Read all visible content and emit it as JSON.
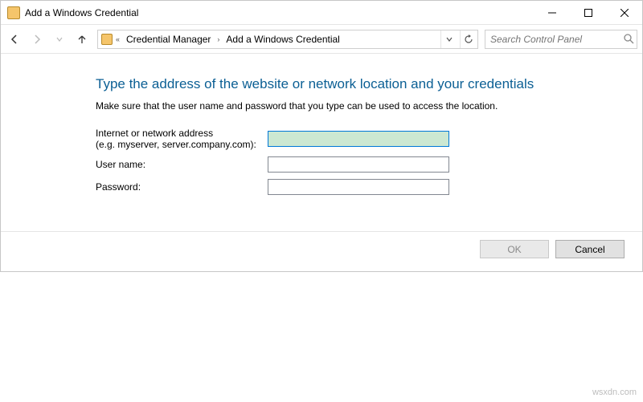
{
  "window": {
    "title": "Add a Windows Credential"
  },
  "breadcrumb": {
    "item1": "Credential Manager",
    "item2": "Add a Windows Credential"
  },
  "search": {
    "placeholder": "Search Control Panel"
  },
  "page": {
    "heading": "Type the address of the website or network location and your credentials",
    "subtext": "Make sure that the user name and password that you type can be used to access the location."
  },
  "form": {
    "address_label": "Internet or network address\n(e.g. myserver, server.company.com):",
    "address_value": "",
    "username_label": "User name:",
    "username_value": "",
    "password_label": "Password:",
    "password_value": ""
  },
  "buttons": {
    "ok": "OK",
    "cancel": "Cancel"
  },
  "watermark": "wsxdn.com"
}
